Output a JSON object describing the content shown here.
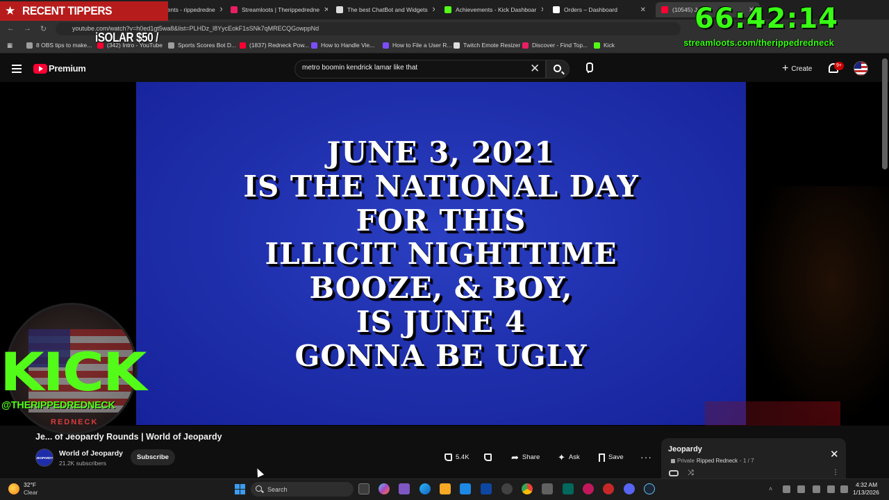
{
  "overlay": {
    "recent_tippers_title": "RECENT TIPPERS",
    "tipper_entry": "iSOLAR $50 /",
    "timer": "66:42:14",
    "streamloots_url": "streamloots.com/therippedredneck",
    "kick_word": "KICK",
    "kick_handle": "@THERIPPEDREDNECK",
    "kick_sub": "REDNECK",
    "timer_color": "#39ff14",
    "kick_color": "#53fc18"
  },
  "browser": {
    "tabs": [
      {
        "label": "StreamElements - rippedredne",
        "favicon": "#7c4dff"
      },
      {
        "label": "Streamloots | Therippedredne",
        "favicon": "#e91e63"
      },
      {
        "label": "The best ChatBot and Widgets",
        "favicon": "#dddddd"
      },
      {
        "label": "Achievements - Kick Dashboar",
        "favicon": "#53fc18"
      },
      {
        "label": "Orders – Dashboard",
        "favicon": "#ffffff"
      },
      {
        "label": "(10545) Just",
        "favicon": "#ff0033"
      }
    ],
    "url": "youtube.com/watch?v=h0ed1gt5wa8&list=PLHDz_l8YycEokF1sSNk7qMRECQGowppNd",
    "bookmarks": [
      {
        "label": "8 OBS tips to make...",
        "favicon": "#9e9e9e"
      },
      {
        "label": "(342) Intro - YouTube",
        "favicon": "#ff0033"
      },
      {
        "label": "Sports Scores Bot D...",
        "favicon": "#9e9e9e"
      },
      {
        "label": "(1837) Redneck Pow...",
        "favicon": "#ff0033"
      },
      {
        "label": "How to Handle Vie...",
        "favicon": "#7c4dff"
      },
      {
        "label": "How to File a User R...",
        "favicon": "#7c4dff"
      },
      {
        "label": "Twitch Emote Resizer",
        "favicon": "#dddddd"
      },
      {
        "label": "Discover - Find Top...",
        "favicon": "#e91e63"
      },
      {
        "label": "Kick",
        "favicon": "#53fc18"
      }
    ]
  },
  "youtube": {
    "brand": "Premium",
    "search_value": "metro boomin kendrick lamar like that",
    "create_label": "Create",
    "notif_count": "9+",
    "clue_lines": [
      "JUNE 3, 2021",
      "IS THE NATIONAL DAY",
      "FOR THIS",
      "ILLICIT NIGHTTIME",
      "BOOZE, & BOY,",
      "IS JUNE 4",
      "GONNA BE UGLY"
    ],
    "video_title": "Je... of Jeopardy Rounds | World of Jeopardy",
    "channel_name": "World of Jeopardy",
    "channel_subs": "21.2K subscribers",
    "channel_avatar_text": "JEOPARDY",
    "subscribe_label": "Subscribe",
    "like_count": "5.4K",
    "share_label": "Share",
    "ask_label": "Ask",
    "save_label": "Save",
    "playlist": {
      "title": "Jeopardy",
      "privacy": "Private",
      "owner": "Ripped Redneck",
      "position": "- 1 / 7"
    }
  },
  "taskbar": {
    "weather_temp": "32°F",
    "weather_cond": "Clear",
    "search_placeholder": "Search",
    "time": "4:32 AM",
    "date": "1/13/2026"
  }
}
